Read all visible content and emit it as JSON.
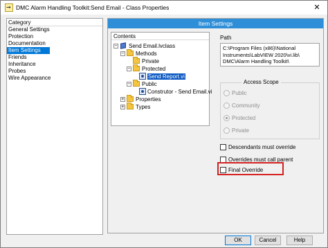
{
  "window": {
    "title": "DMC Alarm Handling Toolkit:Send Email - Class Properties",
    "close_glyph": "✕"
  },
  "category": {
    "header": "Category",
    "items": [
      "General Settings",
      "Protection",
      "Documentation",
      "Item Settings",
      "Friends",
      "Inheritance",
      "Probes",
      "Wire Appearance"
    ],
    "selected": "Item Settings"
  },
  "item_settings": {
    "header": "Item Settings",
    "contents": {
      "header": "Contents",
      "tree": {
        "root": "Send Email.lvclass",
        "methods": "Methods",
        "private": "Private",
        "protected": "Protected",
        "send_report": "Send Report.vi",
        "public": "Public",
        "construtor": "Construtor - Send Email.vi",
        "properties": "Properties",
        "types": "Types"
      },
      "expand_glyph": "−",
      "collapsed_glyph": "+"
    },
    "path": {
      "label": "Path",
      "line1": "C:\\Program Files (x86)\\National",
      "line2": "Instruments\\LabVIEW 2020\\vi.lib\\",
      "line3": "DMC\\Alarm Handling Toolkit\\"
    },
    "access_scope": {
      "title": "Access Scope",
      "options": [
        "Public",
        "Community",
        "Protected",
        "Private"
      ],
      "selected": "Protected",
      "enabled": false
    },
    "checkboxes": {
      "descendants_must_override": "Descendants must override",
      "overrides_must_call_parent": "Overrides must call parent",
      "final_override": "Final Override"
    }
  },
  "buttons": {
    "ok": "OK",
    "cancel": "Cancel",
    "help": "Help"
  },
  "colors": {
    "header_blue": "#2e8fd8",
    "selection_blue": "#0078d7",
    "highlight_red": "#d61f1f"
  }
}
